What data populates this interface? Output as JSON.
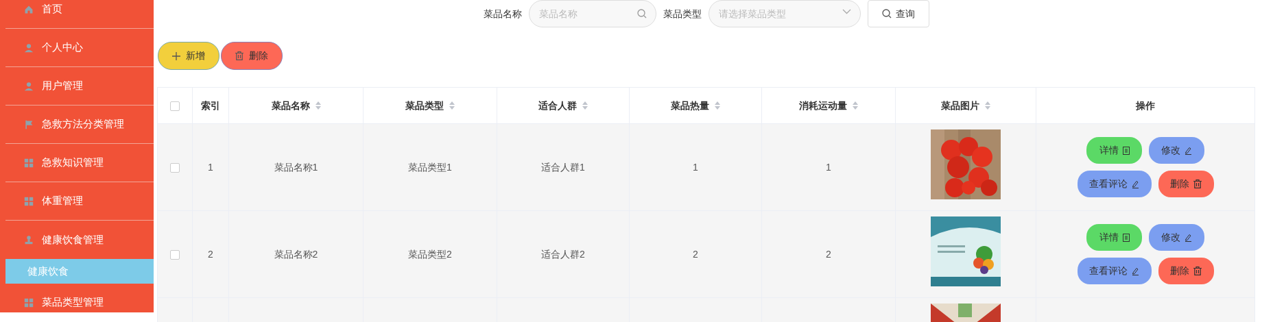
{
  "sidebar": {
    "items": [
      {
        "label": "首页"
      },
      {
        "label": "个人中心"
      },
      {
        "label": "用户管理"
      },
      {
        "label": "急救方法分类管理"
      },
      {
        "label": "急救知识管理"
      },
      {
        "label": "体重管理"
      },
      {
        "label": "健康饮食管理",
        "children": [
          {
            "label": "健康饮食",
            "selected": true
          }
        ]
      },
      {
        "label": "菜品类型管理"
      }
    ]
  },
  "search": {
    "fields": [
      {
        "kind": "input",
        "label": "菜品名称",
        "placeholder": "菜品名称"
      },
      {
        "kind": "select",
        "label": "菜品类型",
        "placeholder": "请选择菜品类型"
      }
    ],
    "button": "查询"
  },
  "toolbar": [
    {
      "kind": "add",
      "label": "新增"
    },
    {
      "kind": "delete",
      "label": "删除"
    }
  ],
  "table": {
    "columns": [
      {
        "kind": "check",
        "checked": false
      },
      {
        "label": "索引",
        "sortable": false
      },
      {
        "label": "菜品名称",
        "sortable": true
      },
      {
        "label": "菜品类型",
        "sortable": true
      },
      {
        "label": "适合人群",
        "sortable": true
      },
      {
        "label": "菜品热量",
        "sortable": true
      },
      {
        "label": "消耗运动量",
        "sortable": true
      },
      {
        "label": "菜品图片",
        "sortable": true
      },
      {
        "label": "操作",
        "sortable": false
      }
    ],
    "rows": [
      {
        "checked": false,
        "cells": [
          "1",
          "菜品名称1",
          "菜品类型1",
          "适合人群1",
          "1",
          "1"
        ],
        "picture": {
          "kind": "picture"
        },
        "actions": [
          {
            "kind": "detail",
            "label": "详情"
          },
          {
            "kind": "edit",
            "label": "修改"
          },
          {
            "kind": "comment",
            "label": "查看评论"
          },
          {
            "kind": "delete",
            "label": "删除"
          }
        ]
      },
      {
        "checked": false,
        "cells": [
          "2",
          "菜品名称2",
          "菜品类型2",
          "适合人群2",
          "2",
          "2"
        ],
        "picture": {
          "kind": "picture"
        },
        "actions": [
          {
            "kind": "detail",
            "label": "详情"
          },
          {
            "kind": "edit",
            "label": "修改"
          },
          {
            "kind": "comment",
            "label": "查看评论"
          },
          {
            "kind": "delete",
            "label": "删除"
          }
        ]
      },
      {
        "picture": {
          "kind": "picture"
        }
      }
    ]
  }
}
